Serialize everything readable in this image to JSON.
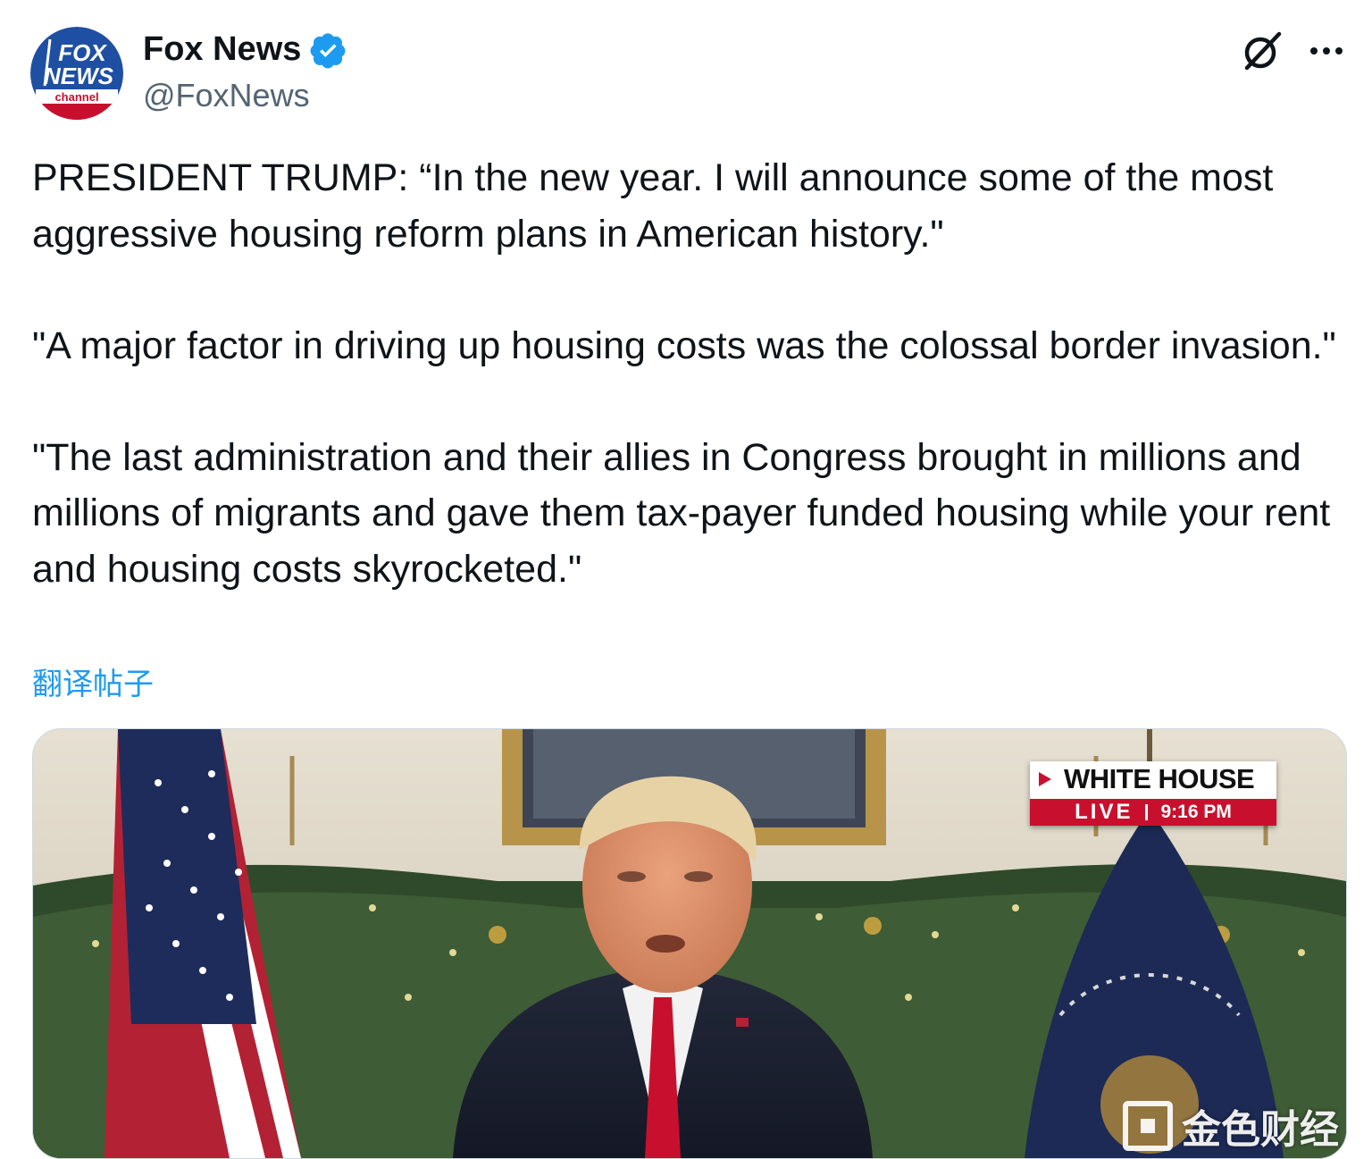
{
  "author": {
    "name": "Fox News",
    "handle": "@FoxNews",
    "avatar_text": {
      "line1": "FOX",
      "line2": "NEWS",
      "line3": "channel"
    },
    "verified_icon": "verified-badge-icon"
  },
  "header_actions": {
    "grok_icon": "grok-icon",
    "more_icon": "more-options-icon"
  },
  "tweet": {
    "text": "PRESIDENT TRUMP: “In the new year. I will announce some of the most aggressive housing reform plans in American history.\"\n\n\"A major factor in driving up housing costs was the colossal border invasion.\"\n\n\"The last administration and their allies in Congress brought in millions and millions of migrants and gave them tax-payer funded housing while your rent and housing costs skyrocketed.\"",
    "translate_label": "翻译帖子"
  },
  "media": {
    "chyron_title": "WHITE HOUSE",
    "chyron_live": "LIVE",
    "chyron_time": "9:16 PM",
    "watermark_text": "金色财经"
  },
  "colors": {
    "link": "#1d9bf0",
    "verified": "#1d9bf0",
    "fox_red": "#c8102e",
    "fox_blue": "#1e4fa3"
  }
}
